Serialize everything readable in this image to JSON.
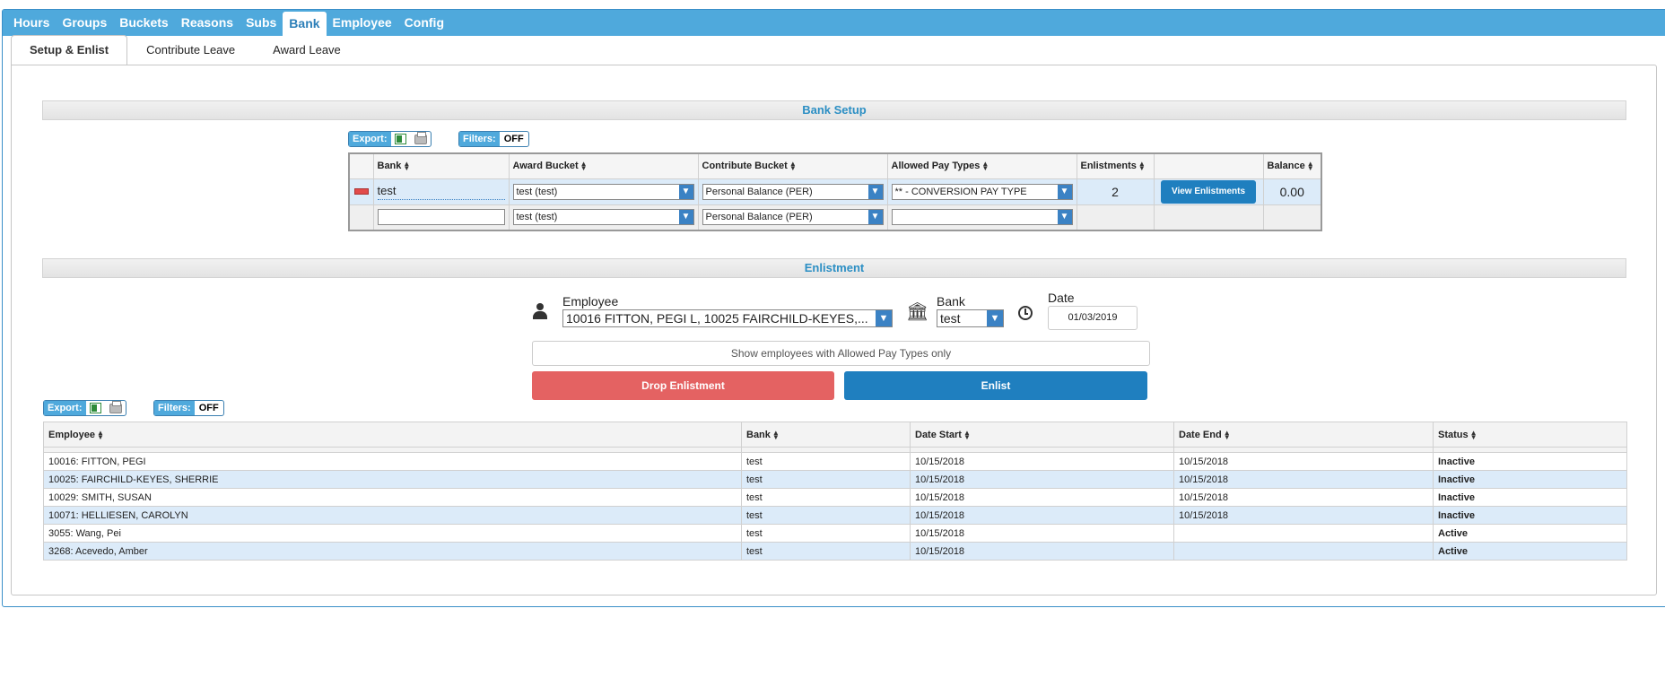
{
  "top_nav": [
    "Hours",
    "Groups",
    "Buckets",
    "Reasons",
    "Subs",
    "Bank",
    "Employee",
    "Config"
  ],
  "top_nav_active": "Bank",
  "tabs": [
    "Setup & Enlist",
    "Contribute Leave",
    "Award Leave"
  ],
  "tabs_active": "Setup & Enlist",
  "bank_setup": {
    "title": "Bank Setup",
    "toolbar": {
      "export_label": "Export:",
      "filters_label": "Filters:",
      "filters_value": "OFF"
    },
    "columns": [
      "Bank",
      "Award Bucket",
      "Contribute Bucket",
      "Allowed Pay Types",
      "Enlistments",
      "",
      "Balance"
    ],
    "row": {
      "bank": "test",
      "award_bucket": "test (test)",
      "contribute_bucket": "Personal Balance (PER)",
      "allowed_pay_types": "** - CONVERSION PAY TYPE",
      "enlistments": "2",
      "view_button": "View Enlistments",
      "balance": "0.00"
    },
    "new_row": {
      "bank": "",
      "award_bucket": "test (test)",
      "contribute_bucket": "Personal Balance (PER)",
      "allowed_pay_types": ""
    }
  },
  "enlistment": {
    "title": "Enlistment",
    "employee_label": "Employee",
    "employee_value": "10016 FITTON, PEGI L, 10025 FAIRCHILD-KEYES,...",
    "bank_label": "Bank",
    "bank_value": "test",
    "date_label": "Date",
    "date_value": "01/03/2019",
    "show_allowed_button": "Show employees with Allowed Pay Types only",
    "drop_button": "Drop Enlistment",
    "enlist_button": "Enlist",
    "toolbar": {
      "export_label": "Export:",
      "filters_label": "Filters:",
      "filters_value": "OFF"
    },
    "columns": [
      "Employee",
      "Bank",
      "Date Start",
      "Date End",
      "Status"
    ],
    "rows": [
      [
        "10016: FITTON, PEGI",
        "test",
        "10/15/2018",
        "10/15/2018",
        "Inactive"
      ],
      [
        "10025: FAIRCHILD-KEYES, SHERRIE",
        "test",
        "10/15/2018",
        "10/15/2018",
        "Inactive"
      ],
      [
        "10029: SMITH, SUSAN",
        "test",
        "10/15/2018",
        "10/15/2018",
        "Inactive"
      ],
      [
        "10071: HELLIESEN, CAROLYN",
        "test",
        "10/15/2018",
        "10/15/2018",
        "Inactive"
      ],
      [
        "3055: Wang, Pei",
        "test",
        "10/15/2018",
        "",
        "Active"
      ],
      [
        "3268: Acevedo, Amber",
        "test",
        "10/15/2018",
        "",
        "Active"
      ]
    ]
  }
}
